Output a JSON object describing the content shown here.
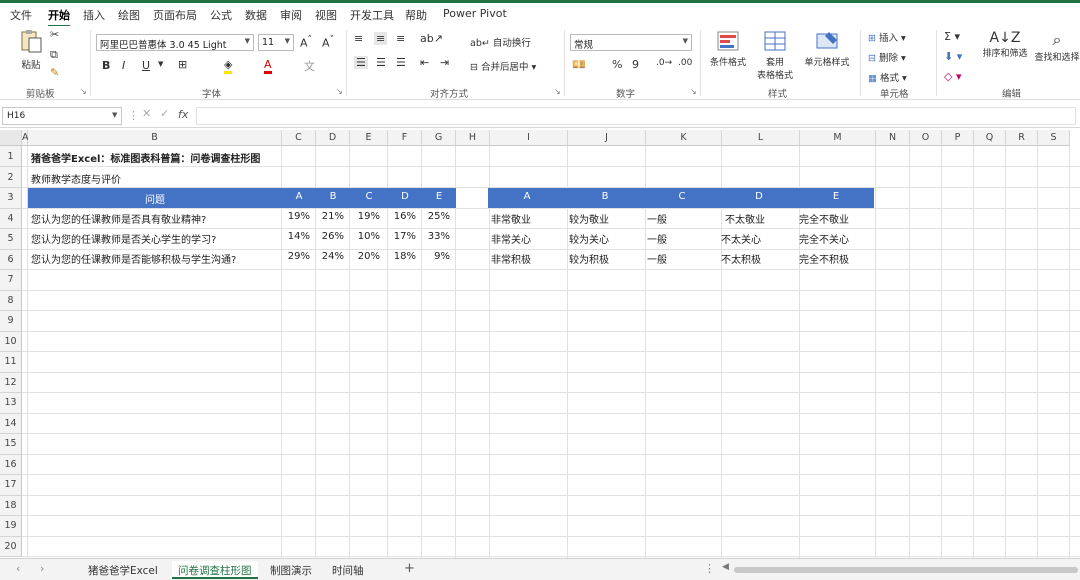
{
  "menu": [
    "文件",
    "开始",
    "插入",
    "绘图",
    "页面布局",
    "公式",
    "数据",
    "审阅",
    "视图",
    "开发工具",
    "帮助",
    "Power Pivot"
  ],
  "ribbon": {
    "clipboard": {
      "paste": "粘贴",
      "label": "剪贴板"
    },
    "font": {
      "name": "阿里巴巴普惠体 3.0 45 Light",
      "size": "11",
      "bold": "B",
      "italic": "I",
      "underline": "U",
      "label": "字体"
    },
    "align": {
      "wrap": "自动换行",
      "merge": "合并后居中",
      "label": "对齐方式"
    },
    "number": {
      "format": "常规",
      "percent": "%",
      "comma": "9",
      "label": "数字"
    },
    "styles": {
      "cond": "条件格式",
      "table_line1": "套用",
      "table_line2": "表格格式",
      "cell_style": "单元格样式",
      "label": "样式"
    },
    "cells": {
      "insert": "插入",
      "delete": "删除",
      "format": "格式",
      "label": "单元格"
    },
    "edit": {
      "sort": "排序和筛选",
      "find": "查找和选择",
      "label": "编辑"
    }
  },
  "formula": {
    "namebox": "H16",
    "fx": "fx",
    "value": ""
  },
  "columns": [
    "A",
    "B",
    "C",
    "D",
    "E",
    "F",
    "G",
    "H",
    "I",
    "J",
    "K",
    "L",
    "M",
    "N",
    "O",
    "P",
    "Q",
    "R",
    "S"
  ],
  "rows": [
    "1",
    "2",
    "3",
    "4",
    "5",
    "6",
    "7",
    "8",
    "9",
    "10",
    "11",
    "12",
    "13",
    "14",
    "15",
    "16",
    "17",
    "18",
    "19",
    "20"
  ],
  "sheet": {
    "title": "猪爸爸学Excel：标准图表科普篇：问卷调查柱形图",
    "subtitle": "教师教学态度与评价",
    "left_header": [
      "问题",
      "A",
      "B",
      "C",
      "D",
      "E"
    ],
    "left_rows": [
      [
        "您认为您的任课教师是否具有敬业精神?",
        "19%",
        "21%",
        "19%",
        "16%",
        "25%"
      ],
      [
        "您认为您的任课教师是否关心学生的学习?",
        "14%",
        "26%",
        "10%",
        "17%",
        "33%"
      ],
      [
        "您认为您的任课教师是否能够积极与学生沟通?",
        "29%",
        "24%",
        "20%",
        "18%",
        "9%"
      ]
    ],
    "right_header": [
      "A",
      "B",
      "C",
      "D",
      "E"
    ],
    "right_rows": [
      [
        "非常敬业",
        "较为敬业",
        "一般",
        "不太敬业",
        "完全不敬业"
      ],
      [
        "非常关心",
        "较为关心",
        "一般",
        "不太关心",
        "完全不关心"
      ],
      [
        "非常积极",
        "较为积极",
        "一般",
        "不太积极",
        "完全不积极"
      ]
    ]
  },
  "tabs": [
    "猪爸爸学Excel",
    "问卷调查柱形图",
    "制图演示",
    "时间轴"
  ],
  "add_sheet": "+",
  "colors": {
    "accent": "#217346",
    "header_band": "#4472c4"
  }
}
